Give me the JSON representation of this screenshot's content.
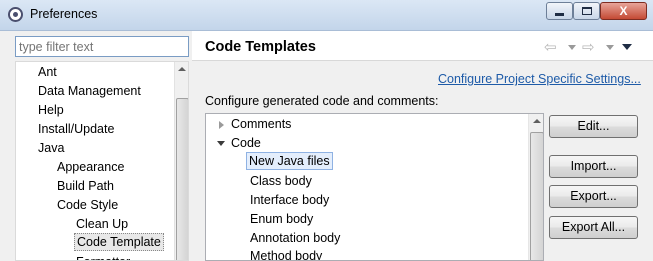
{
  "window": {
    "title": "Preferences",
    "controls": {
      "minimize_icon": "minimize-icon",
      "maximize_icon": "maximize-icon",
      "close_glyph": "X"
    }
  },
  "sidebar": {
    "filter_placeholder": "type filter text",
    "items": [
      {
        "label": "Ant",
        "level": 1
      },
      {
        "label": "Data Management",
        "level": 1
      },
      {
        "label": "Help",
        "level": 1
      },
      {
        "label": "Install/Update",
        "level": 1
      },
      {
        "label": "Java",
        "level": 1
      },
      {
        "label": "Appearance",
        "level": 2
      },
      {
        "label": "Build Path",
        "level": 2
      },
      {
        "label": "Code Style",
        "level": 2
      },
      {
        "label": "Clean Up",
        "level": 3
      },
      {
        "label": "Code Template",
        "level": 3,
        "selected": true
      },
      {
        "label": "Formatter",
        "level": 3
      }
    ]
  },
  "page": {
    "title": "Code Templates",
    "nav": {
      "back_icon": "back-arrow-icon",
      "forward_icon": "forward-arrow-icon",
      "menu_icon": "view-menu-icon",
      "back_glyph": "⇦",
      "forward_glyph": "⇨"
    },
    "config_link": "Configure Project Specific Settings...",
    "description": "Configure generated code and comments:",
    "templates": [
      {
        "label": "Comments",
        "type": "group",
        "expanded": false
      },
      {
        "label": "Code",
        "type": "group",
        "expanded": true
      },
      {
        "label": "New Java files",
        "type": "leaf",
        "selected": true
      },
      {
        "label": "Class body",
        "type": "leaf"
      },
      {
        "label": "Interface body",
        "type": "leaf"
      },
      {
        "label": "Enum body",
        "type": "leaf"
      },
      {
        "label": "Annotation body",
        "type": "leaf"
      },
      {
        "label": "Method body",
        "type": "leaf"
      }
    ],
    "buttons": {
      "edit": "Edit...",
      "import": "Import...",
      "export": "Export...",
      "export_all": "Export All..."
    }
  },
  "colors": {
    "link": "#1e5ba8",
    "selection_bg": "#e4eefc",
    "selection_border": "#8fb2e3",
    "close_button": "#c44a34"
  }
}
